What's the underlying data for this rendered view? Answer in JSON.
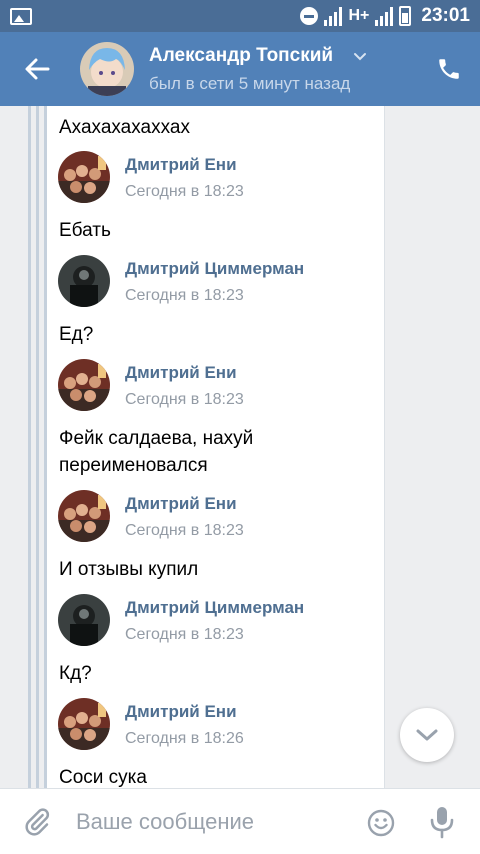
{
  "status_bar": {
    "network": "H+",
    "time": "23:01"
  },
  "header": {
    "name": "Александр Топский",
    "status": "был в сети 5 минут назад",
    "icons": [
      "back-arrow-icon",
      "chevron-down-icon",
      "phone-icon"
    ]
  },
  "chat": {
    "messages": [
      {
        "text": "Ахахахахаххах"
      },
      {
        "author": "Дмитрий Ени",
        "time": "Сегодня в 18:23",
        "avatar": "group-photo",
        "text": "Ебать"
      },
      {
        "author": "Дмитрий Циммерман",
        "time": "Сегодня в 18:23",
        "avatar": "dark-photo",
        "text": "Ед?"
      },
      {
        "author": "Дмитрий Ени",
        "time": "Сегодня в 18:23",
        "avatar": "group-photo",
        "text_line1": "Фейк салдаева, нахуй",
        "text_line2": "переименовался"
      },
      {
        "author": "Дмитрий Ени",
        "time": "Сегодня в 18:23",
        "avatar": "group-photo",
        "text": "И отзывы купил"
      },
      {
        "author": "Дмитрий Циммерман",
        "time": "Сегодня в 18:23",
        "avatar": "dark-photo",
        "text": "Кд?"
      },
      {
        "author": "Дмитрий Ени",
        "time": "Сегодня в 18:26",
        "avatar": "group-photo",
        "text": "Соси сука"
      }
    ]
  },
  "composer": {
    "placeholder": "Ваше сообщение",
    "icons": [
      "paperclip-icon",
      "emoji-icon",
      "microphone-icon"
    ]
  },
  "colors": {
    "header": "#5181b8",
    "status_bar": "#4a6d96",
    "author": "#4f6f91",
    "background": "#edeef0"
  }
}
